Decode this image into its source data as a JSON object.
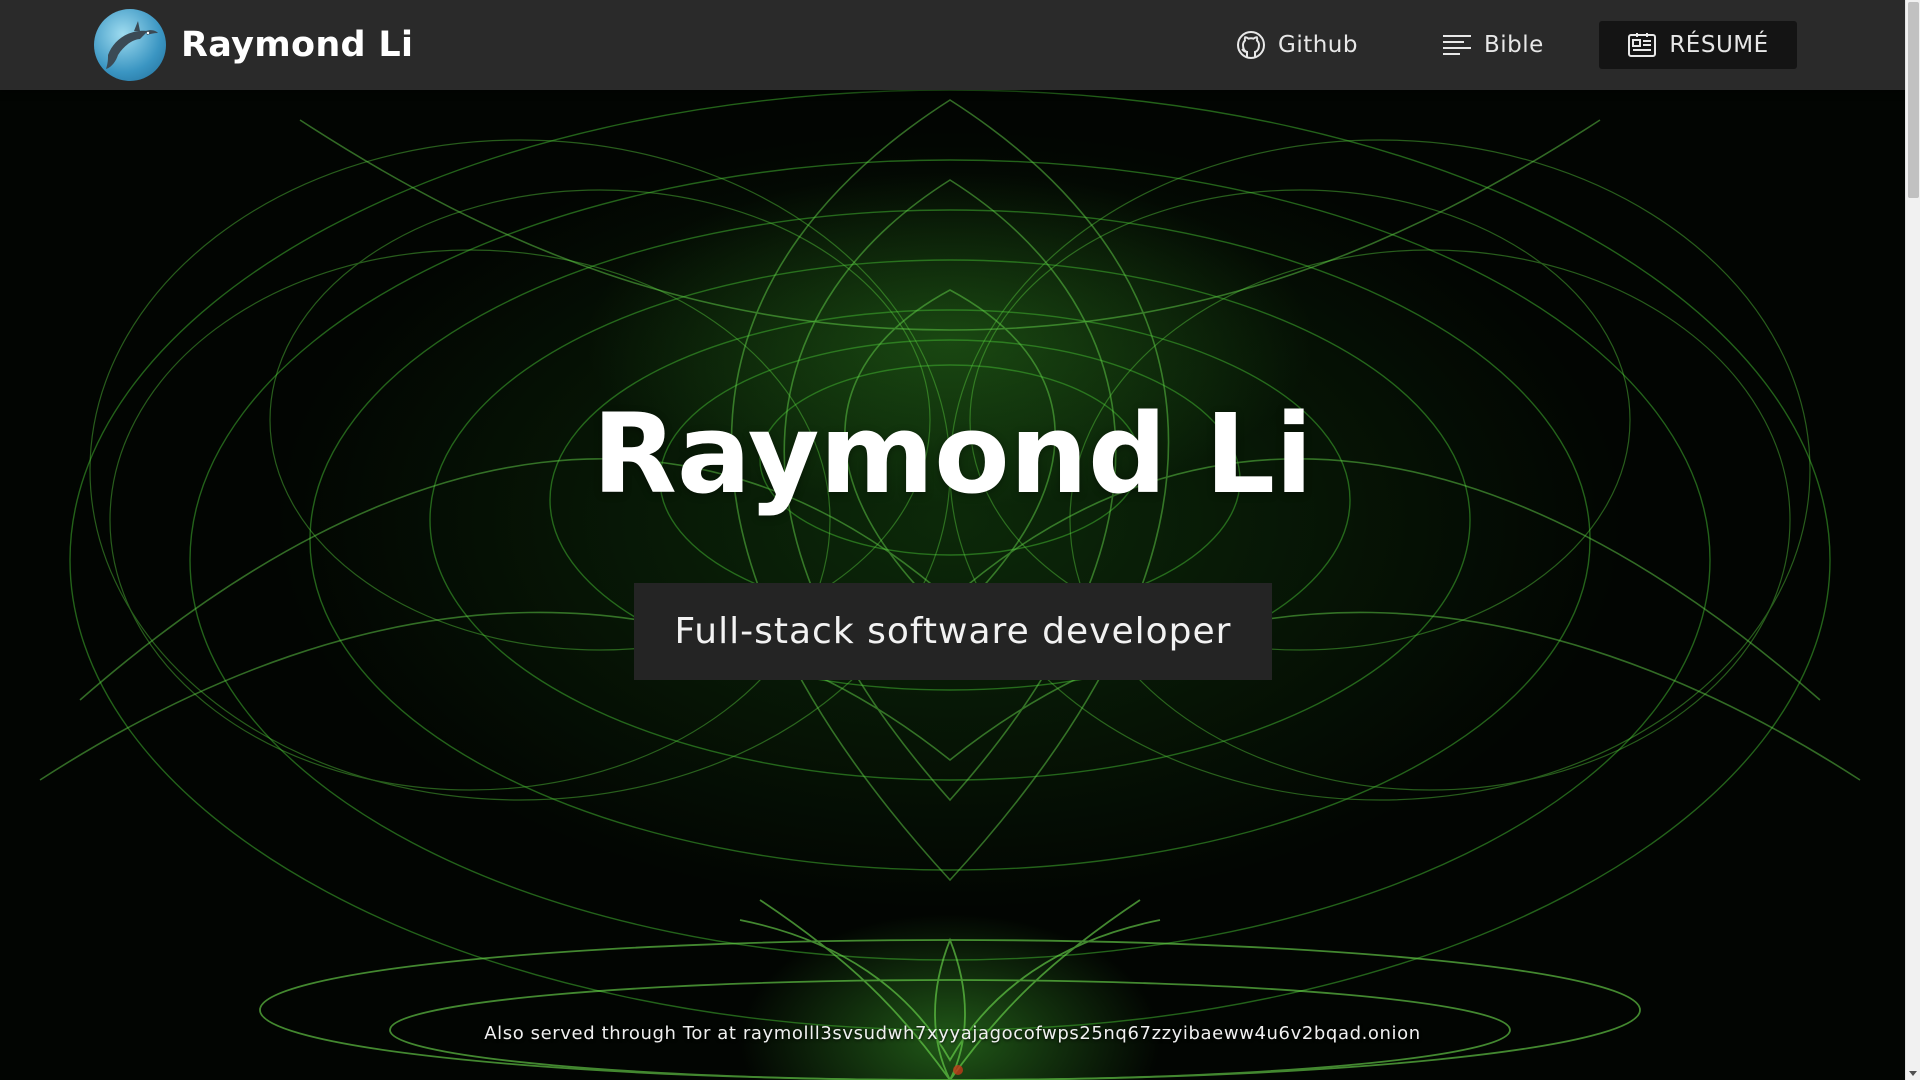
{
  "navbar": {
    "brand_name": "Raymond Li",
    "links": [
      {
        "label": "Github",
        "icon": "github-icon"
      },
      {
        "label": "Bible",
        "icon": "text-lines-icon"
      },
      {
        "label": "RÉSUMÉ",
        "icon": "resume-icon"
      }
    ]
  },
  "hero": {
    "title": "Raymond Li",
    "subtitle": "Full-stack software developer"
  },
  "footer": {
    "tor_note": "Also served through Tor at raymolll3svsudwh7xyyajagocofwps25nq67zzyibaeww4u6v2bqad.onion"
  },
  "colors": {
    "navbar_bg": "#2a2a2a",
    "accent_green": "#4fbf3a",
    "subtitle_bg": "#242424"
  }
}
